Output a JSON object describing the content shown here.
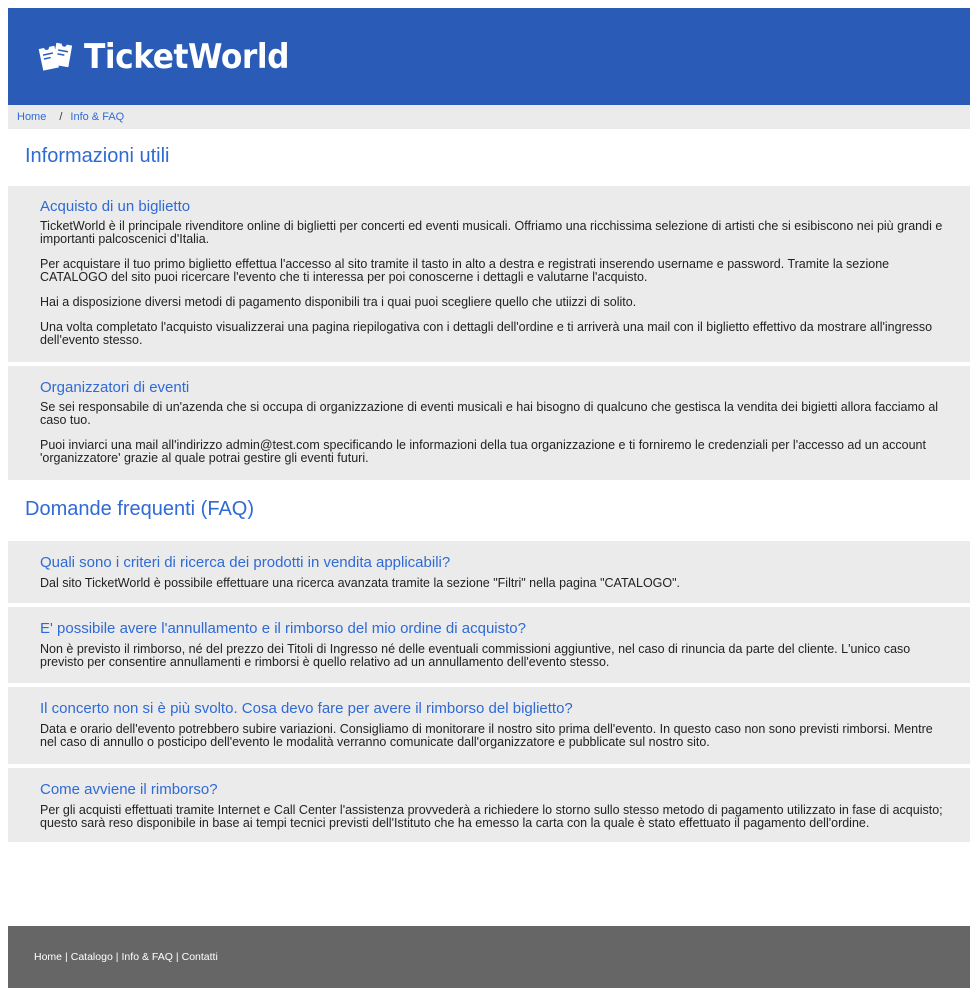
{
  "header": {
    "logo_text": "TicketWorld"
  },
  "breadcrumb": {
    "home": "Home",
    "separator": "/",
    "current": "Info & FAQ"
  },
  "info": {
    "title": "Informazioni utili",
    "sections": [
      {
        "title": "Acquisto di un biglietto",
        "paragraphs": [
          "TicketWorld è il principale rivenditore online di biglietti per concerti ed eventi musicali. Offriamo una ricchissima selezione di artisti che si esibiscono nei più grandi e importanti palcoscenici d'Italia.",
          "Per acquistare il tuo primo biglietto effettua l'accesso al sito tramite il tasto in alto a destra e registrati inserendo username e password. Tramite la sezione CATALOGO del sito puoi ricercare l'evento che ti interessa per poi conoscerne i dettagli e valutarne l'acquisto.",
          "Hai a disposizione diversi metodi di pagamento disponibili tra i quai puoi scegliere quello che utiizzi di solito.",
          "Una volta completato l'acquisto visualizzerai una pagina riepilogativa con i dettagli dell'ordine e ti arriverà una mail con il biglietto effettivo da mostrare all'ingresso dell'evento stesso."
        ]
      },
      {
        "title": "Organizzatori di eventi",
        "paragraphs": [
          "Se sei responsabile di un'azenda che si occupa di organizzazione di eventi musicali e hai bisogno di qualcuno che gestisca la vendita dei bigietti allora facciamo al caso tuo.",
          "Puoi inviarci una mail all'indirizzo admin@test.com specificando le informazioni della tua organizzazione e ti forniremo le credenziali per l'accesso ad un account 'organizzatore' grazie al quale potrai gestire gli eventi futuri."
        ]
      }
    ]
  },
  "faq": {
    "title": "Domande frequenti (FAQ)",
    "items": [
      {
        "question": "Quali sono i criteri di ricerca dei prodotti in vendita applicabili?",
        "answer": "Dal sito TicketWorld è possibile effettuare una ricerca avanzata tramite la sezione \"Filtri\" nella pagina \"CATALOGO\"."
      },
      {
        "question": "E' possibile avere l'annullamento e il rimborso del mio ordine di acquisto?",
        "answer": "Non è previsto il rimborso, né del prezzo dei Titoli di Ingresso né delle eventuali commissioni aggiuntive, nel caso di rinuncia da parte del cliente. L'unico caso previsto per consentire annullamenti e rimborsi è quello relativo ad un annullamento dell'evento stesso."
      },
      {
        "question": "Il concerto non si è più svolto. Cosa devo fare per avere il rimborso del biglietto?",
        "answer": "Data e orario dell'evento potrebbero subire variazioni. Consigliamo di monitorare il nostro sito prima dell'evento. In questo caso non sono previsti rimborsi. Mentre nel caso di annullo o posticipo dell'evento le modalità verranno comunicate dall'organizzatore e pubblicate sul nostro sito."
      },
      {
        "question": "Come avviene il rimborso?",
        "answer": "Per gli acquisti effettuati tramite Internet e Call Center l'assistenza provvederà a richiedere lo storno sullo stesso metodo di pagamento utilizzato in fase di acquisto; questo sarà reso disponibile in base ai tempi tecnici previsti dell'Istituto che ha emesso la carta con la quale è stato effettuato il pagamento dell'ordine."
      }
    ]
  },
  "footer": {
    "links": [
      "Home",
      "Catalogo",
      "Info & FAQ",
      "Contatti"
    ],
    "separator": "|"
  },
  "colors": {
    "brand": "#2a5cb7",
    "link": "#2f6ad6",
    "card": "#ebebeb",
    "footer": "#666666"
  }
}
